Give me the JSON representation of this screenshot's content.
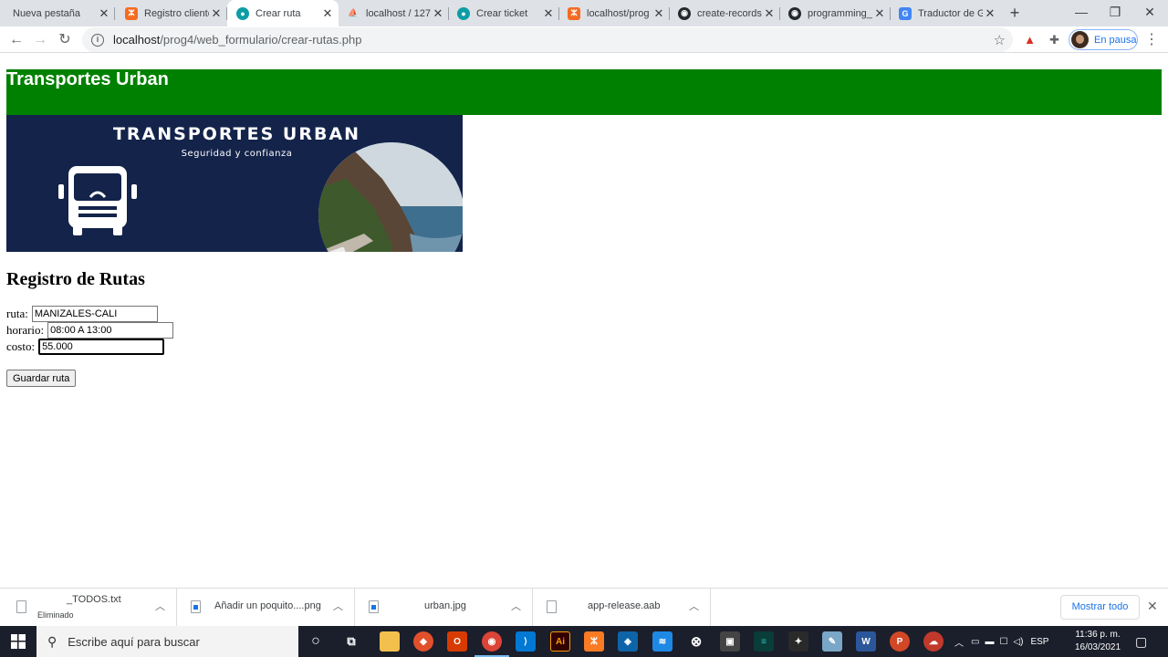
{
  "browser": {
    "tabs": [
      {
        "title": "Nueva pestaña",
        "icon": "none",
        "color": "#dee1e6"
      },
      {
        "title": "Registro cliente",
        "icon": "xampp-icon",
        "color": "#f46b21"
      },
      {
        "title": "Crear ruta",
        "icon": "app-icon",
        "color": "#0d9da6"
      },
      {
        "title": "localhost / 127",
        "icon": "phpmyadmin-icon",
        "color": "#f39c12"
      },
      {
        "title": "Crear ticket",
        "icon": "app-icon",
        "color": "#0d9da6"
      },
      {
        "title": "localhost/prog",
        "icon": "xampp-icon",
        "color": "#f46b21"
      },
      {
        "title": "create-records",
        "icon": "github-icon",
        "color": "#24292e"
      },
      {
        "title": "programming_",
        "icon": "github-icon",
        "color": "#24292e"
      },
      {
        "title": "Traductor de G",
        "icon": "google-translate-icon",
        "color": "#4285f4"
      }
    ],
    "active_tab": 2,
    "address": {
      "host": "localhost",
      "path": "/prog4/web_formulario/crear-rutas.php"
    },
    "profile_label": "En pausa"
  },
  "page": {
    "header_title": "Transportes Urban",
    "banner": {
      "title": "TRANSPORTES URBAN",
      "subtitle": "Seguridad y confianza"
    },
    "form": {
      "title": "Registro de Rutas",
      "fields": [
        {
          "label": "ruta:",
          "value": "MANIZALES-CALI"
        },
        {
          "label": "horario:",
          "value": "08:00 A 13:00"
        },
        {
          "label": "costo:",
          "value": "55.000"
        }
      ],
      "submit_label": "Guardar ruta"
    },
    "colors": {
      "header_bg": "#008000",
      "banner_bg": "#13234a"
    }
  },
  "downloads": {
    "items": [
      {
        "name": "_TODOS.txt",
        "status": "Eliminado",
        "kind": "text-file-icon"
      },
      {
        "name": "Añadir un poquito....png",
        "status": "",
        "kind": "image-file-icon"
      },
      {
        "name": "urban.jpg",
        "status": "",
        "kind": "image-file-icon"
      },
      {
        "name": "app-release.aab",
        "status": "",
        "kind": "file-icon"
      }
    ],
    "show_all_label": "Mostrar todo"
  },
  "taskbar": {
    "search_placeholder": "Escribe aquí para buscar",
    "language": "ESP",
    "time": "11:36 p. m.",
    "date": "16/03/2021"
  }
}
